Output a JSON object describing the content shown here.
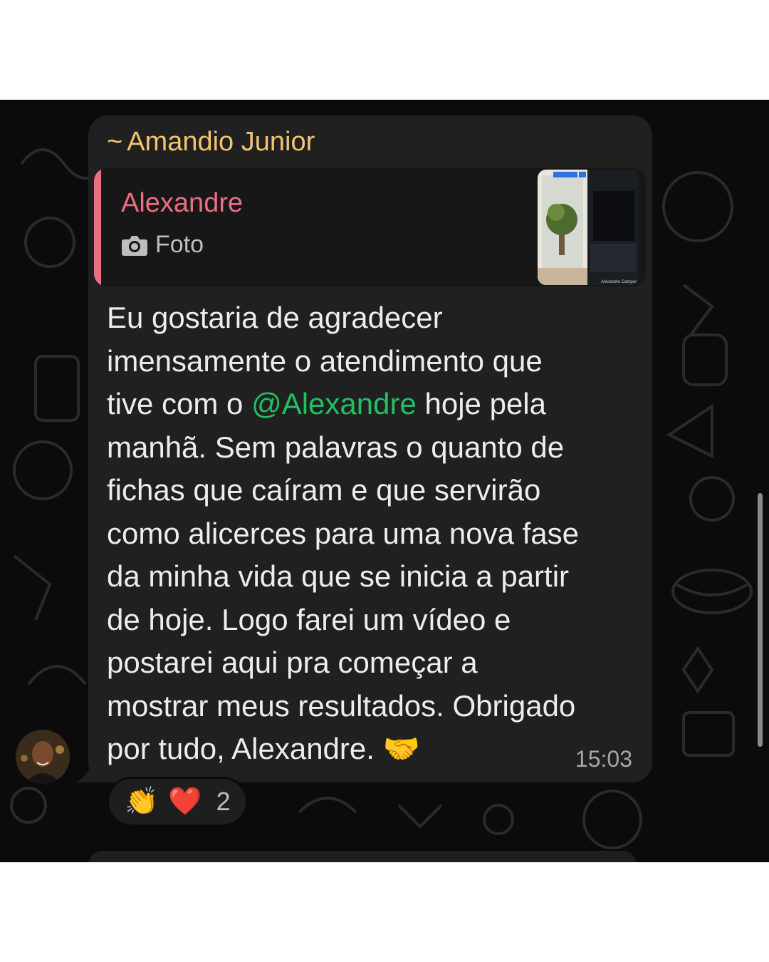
{
  "message": {
    "sender_prefix": "~",
    "sender": "Amandio Junior",
    "quote": {
      "author": "Alexandre",
      "kind_label": "Foto",
      "kind_icon": "camera-icon",
      "thumbnail_caption": "Alexandre Campos"
    },
    "text_before": "Eu gostaria de agradecer\nimensamente o atendimento que\ntive com o ",
    "mention": "@Alexandre",
    "text_after": " hoje pela\nmanhã. Sem palavras o quanto de\nfichas que caíram e que servirão\ncomo alicerces para uma nova fase\nda minha vida que se inicia a partir\nde hoje. Logo farei um vídeo e\npostarei aqui pra começar a\nmostrar meus resultados. Obrigado\npor tudo, Alexandre. ",
    "emoji": "🤝",
    "time": "15:03"
  },
  "reactions": {
    "emojis": [
      "👏",
      "❤️"
    ],
    "count": "2"
  },
  "colors": {
    "sender": "#f2c46f",
    "quote_author": "#ec6e80",
    "mention": "#21c063",
    "bubble": "#202020",
    "background": "#0b0b0b"
  }
}
